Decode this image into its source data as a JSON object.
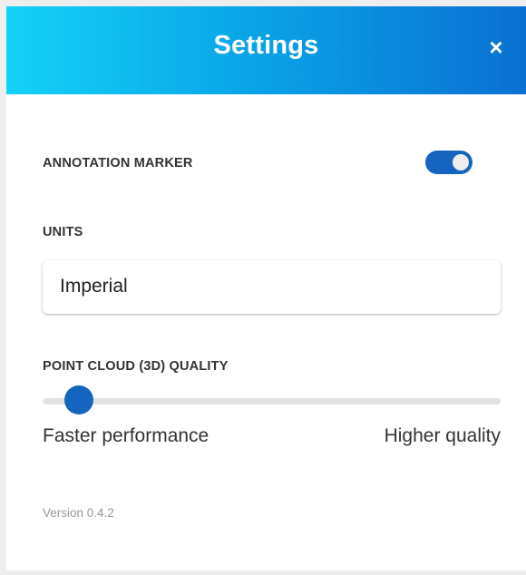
{
  "header": {
    "title": "Settings",
    "close_symbol": "×"
  },
  "annotation_marker": {
    "label": "ANNOTATION MARKER",
    "enabled": true
  },
  "units": {
    "label": "UNITS",
    "selected": "Imperial"
  },
  "point_cloud_quality": {
    "label": "POINT CLOUD (3D) QUALITY",
    "min_label": "Faster performance",
    "max_label": "Higher quality",
    "value": 0.08
  },
  "footer": {
    "version": "Version 0.4.2"
  },
  "colors": {
    "accent": "#1565c0",
    "header_gradient_start": "#14d2f7",
    "header_gradient_end": "#0a70d3"
  },
  "icons": {
    "close": "close-icon"
  }
}
